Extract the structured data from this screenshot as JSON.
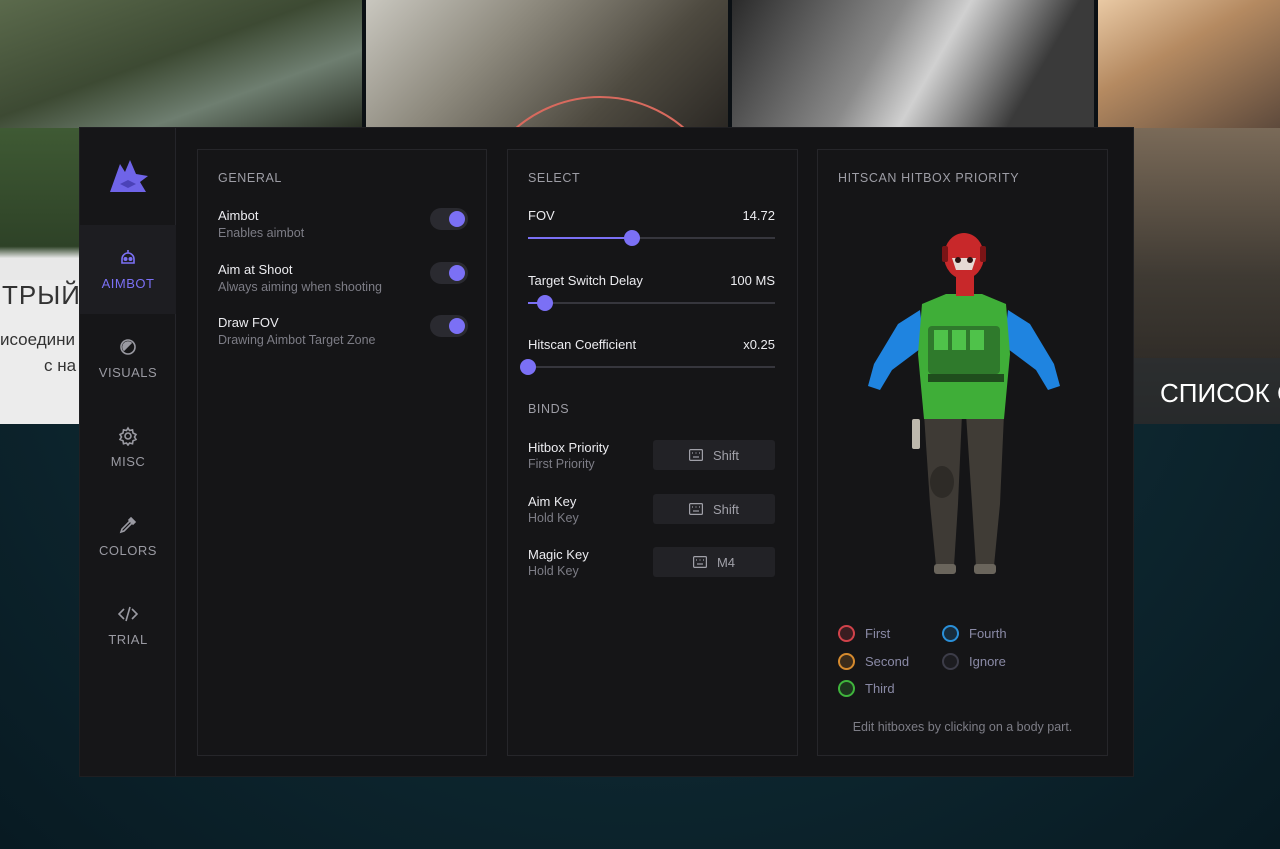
{
  "background": {
    "left_heading": "ТРЫЙ М",
    "left_line1": "исоедини",
    "left_line2": "с на",
    "right_caption": "СПИСОК С"
  },
  "nav": {
    "items": [
      {
        "label": "AIMBOT",
        "icon": "robot-icon",
        "active": true
      },
      {
        "label": "VISUALS",
        "icon": "eye-icon",
        "active": false
      },
      {
        "label": "MISC",
        "icon": "gear-icon",
        "active": false
      },
      {
        "label": "COLORS",
        "icon": "eyedropper-icon",
        "active": false
      },
      {
        "label": "TRIAL",
        "icon": "code-icon",
        "active": false
      }
    ]
  },
  "general": {
    "title": "GENERAL",
    "options": [
      {
        "title": "Aimbot",
        "subtitle": "Enables aimbot",
        "enabled": true
      },
      {
        "title": "Aim at Shoot",
        "subtitle": "Always aiming when shooting",
        "enabled": true
      },
      {
        "title": "Draw FOV",
        "subtitle": "Drawing Aimbot Target Zone",
        "enabled": true
      }
    ]
  },
  "select": {
    "title": "SELECT",
    "sliders": [
      {
        "label": "FOV",
        "value": "14.72",
        "fraction": 0.42
      },
      {
        "label": "Target Switch Delay",
        "value": "100 MS",
        "fraction": 0.07
      },
      {
        "label": "Hitscan Coefficient",
        "value": "x0.25",
        "fraction": 0.0
      }
    ],
    "binds_title": "BINDS",
    "binds": [
      {
        "title": "Hitbox Priority",
        "subtitle": "First Priority",
        "key": "Shift"
      },
      {
        "title": "Aim Key",
        "subtitle": "Hold Key",
        "key": "Shift"
      },
      {
        "title": "Magic Key",
        "subtitle": "Hold Key",
        "key": "M4"
      }
    ]
  },
  "hitbox": {
    "title": "HITSCAN HITBOX PRIORITY",
    "legend": [
      {
        "label": "First",
        "color": "#d0424a"
      },
      {
        "label": "Second",
        "color": "#d58a2e"
      },
      {
        "label": "Third",
        "color": "#3fb43c"
      },
      {
        "label": "Fourth",
        "color": "#2a8fd8"
      },
      {
        "label": "Ignore",
        "color": "#3c3c48"
      }
    ],
    "hint": "Edit hitboxes by clicking on a body part."
  },
  "colors": {
    "accent": "#7b70f5",
    "head": "#c8282a",
    "torso": "#3fae38",
    "arms": "#1f84e0"
  }
}
